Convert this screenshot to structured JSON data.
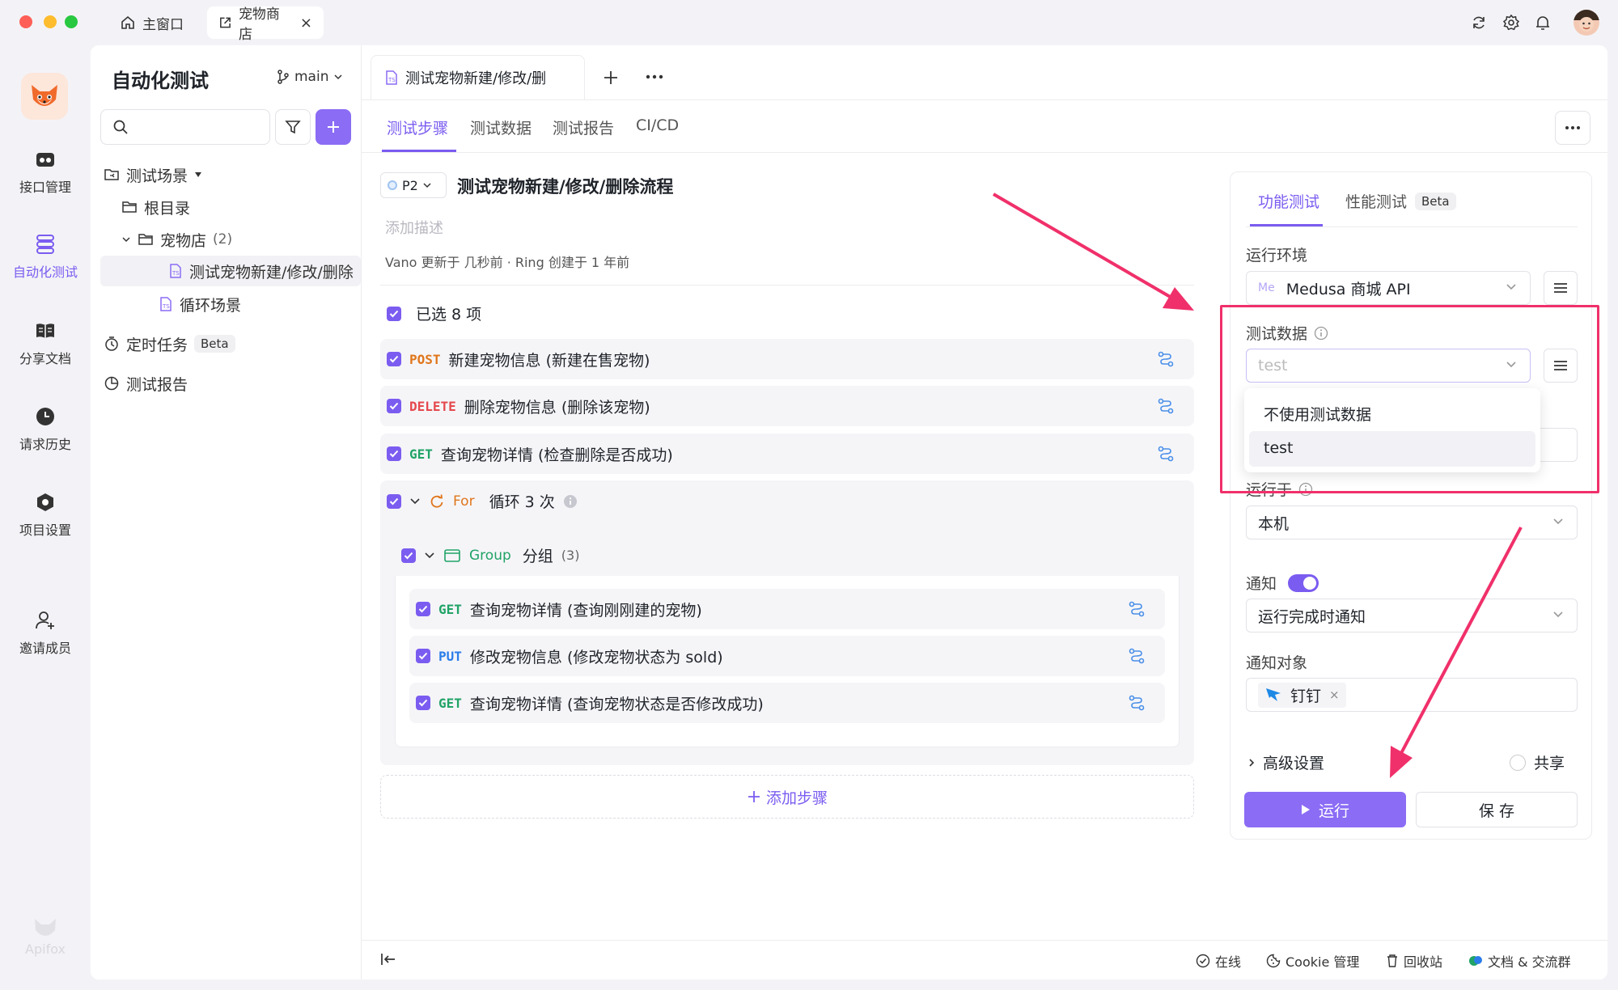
{
  "window": {
    "tabs": [
      {
        "label": "主窗口",
        "icon": "home-icon"
      },
      {
        "label": "宠物商店",
        "icon": "external-link-icon"
      }
    ]
  },
  "rail": {
    "brand": "Apifox",
    "items": [
      {
        "label": "接口管理",
        "icon": "api-icon"
      },
      {
        "label": "自动化测试",
        "icon": "automation-icon",
        "active": true
      },
      {
        "label": "分享文档",
        "icon": "book-icon"
      },
      {
        "label": "请求历史",
        "icon": "clock-icon"
      },
      {
        "label": "项目设置",
        "icon": "settings-hex-icon"
      },
      {
        "label": "邀请成员",
        "icon": "user-plus-icon"
      }
    ]
  },
  "sidebar": {
    "title": "自动化测试",
    "branch": "main",
    "search_placeholder": "",
    "tree": [
      {
        "label": "测试场景",
        "kind": "section"
      },
      {
        "label": "根目录",
        "kind": "folder"
      },
      {
        "label": "宠物店",
        "count": "(2)",
        "kind": "folder-open"
      },
      {
        "label": "测试宠物新建/修改/删除",
        "kind": "scenario",
        "selected": true
      },
      {
        "label": "循环场景",
        "kind": "scenario"
      }
    ],
    "scheduled": "定时任务",
    "beta": "Beta",
    "reports": "测试报告"
  },
  "editor": {
    "tab_title": "测试宠物新建/修改/删",
    "subtabs": [
      "测试步骤",
      "测试数据",
      "测试报告",
      "CI/CD"
    ],
    "priority": "P2",
    "title": "测试宠物新建/修改/删除流程",
    "desc_placeholder": "添加描述",
    "meta": "Vano 更新于 几秒前 · Ring 创建于 1 年前",
    "selected_count": "已选 8 项",
    "steps": [
      {
        "method": "POST",
        "name": "新建宠物信息 (新建在售宠物)"
      },
      {
        "method": "DELETE",
        "name": "删除宠物信息 (删除该宠物)"
      },
      {
        "method": "GET",
        "name": "查询宠物详情 (检查删除是否成功)"
      }
    ],
    "loop": {
      "keyword": "For",
      "label": "循环 3 次"
    },
    "group": {
      "keyword": "Group",
      "label": "分组",
      "count": "(3)"
    },
    "group_steps": [
      {
        "method": "GET",
        "name": "查询宠物详情 (查询刚刚建的宠物)"
      },
      {
        "method": "PUT",
        "name": "修改宠物信息 (修改宠物状态为 sold)"
      },
      {
        "method": "GET",
        "name": "查询宠物详情 (查询宠物状态是否修改成功)"
      }
    ],
    "add_step": "添加步骤"
  },
  "run_panel": {
    "tabs": [
      "功能测试",
      "性能测试"
    ],
    "beta": "Beta",
    "env_label": "运行环境",
    "env_prefix": "Me",
    "env_value": "Medusa 商城 API",
    "data_label": "测试数据",
    "data_value": "test",
    "dropdown_options": [
      "不使用测试数据",
      "test"
    ],
    "runner_label": "运行于",
    "runner_value": "本机",
    "notify_label": "通知",
    "notify_on": true,
    "notify_value": "运行完成时通知",
    "notify_target_label": "通知对象",
    "notify_target": "钉钉",
    "advanced": "高级设置",
    "share": "共享",
    "run": "运行",
    "save": "保 存"
  },
  "bottom_bar": {
    "online": "在线",
    "cookie": "Cookie 管理",
    "trash": "回收站",
    "docs": "文档 & 交流群"
  },
  "colors": {
    "accent": "#7b5cf0",
    "highlight_box": "#f0306a",
    "post": "#e0761b",
    "delete": "#e5484d",
    "get": "#21a366",
    "put": "#2b7de9"
  }
}
